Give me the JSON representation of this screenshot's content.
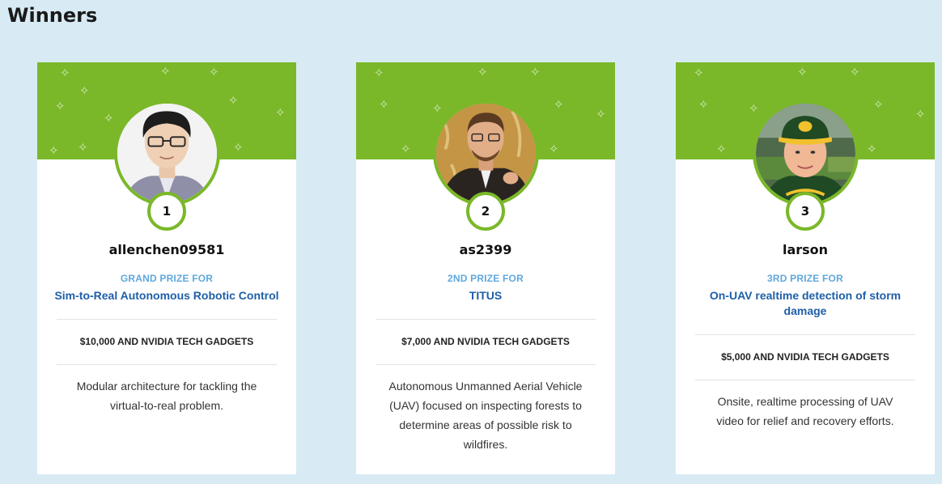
{
  "page": {
    "title": "Winners"
  },
  "colors": {
    "accent_green": "#7ab829",
    "label_blue": "#5fa8dc",
    "project_blue": "#1e5fa8",
    "background": "#d8ebf5"
  },
  "winners": [
    {
      "rank": "1",
      "username": "allenchen09581",
      "prize_label": "GRAND PRIZE FOR",
      "project": "Sim-to-Real Autonomous Robotic Control",
      "prize": "$10,000 AND NVIDIA TECH GADGETS",
      "description": "Modular architecture for tackling the virtual-to-real problem."
    },
    {
      "rank": "2",
      "username": "as2399",
      "prize_label": "2ND PRIZE FOR",
      "project": "TITUS",
      "prize": "$7,000 AND NVIDIA TECH GADGETS",
      "description": "Autonomous Unmanned Aerial Vehicle (UAV) focused on inspecting forests to determine areas of possible risk to wildfires."
    },
    {
      "rank": "3",
      "username": "larson",
      "prize_label": "3RD PRIZE FOR",
      "project": "On-UAV realtime detection of storm damage",
      "prize": "$5,000 AND NVIDIA TECH GADGETS",
      "description": "Onsite, realtime processing of UAV video for relief and recovery efforts."
    }
  ]
}
